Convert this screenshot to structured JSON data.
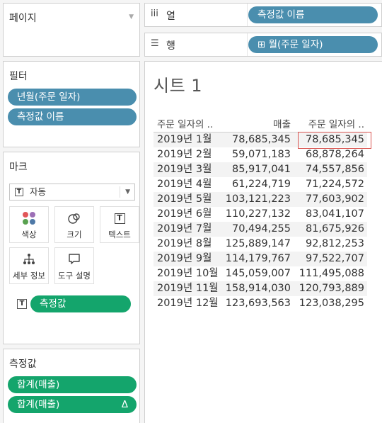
{
  "pages_card": {
    "title": "페이지"
  },
  "filters_card": {
    "title": "필터",
    "pills": [
      "년월(주문 일자)",
      "측정값 이름"
    ]
  },
  "marks_card": {
    "title": "마크",
    "mark_type": "자동",
    "buttons": {
      "color": "색상",
      "size": "크기",
      "text": "텍스트",
      "detail": "세부 정보",
      "tooltip": "도구 설명"
    },
    "text_pill": "측정값"
  },
  "measures_card": {
    "title": "측정값",
    "pills": [
      {
        "label": "합계(매출)",
        "delta": ""
      },
      {
        "label": "합계(매출)",
        "delta": "Δ"
      }
    ]
  },
  "columns_shelf": {
    "label": "열",
    "pill": "측정값 이름"
  },
  "rows_shelf": {
    "label": "행",
    "pill": "⊞ 월(주문 일자)"
  },
  "view": {
    "title": "시트 1",
    "headers": [
      "주문 일자의 ..",
      "매출",
      "주문 일자의 .."
    ],
    "rows": [
      [
        "2019년 1월",
        "78,685,345",
        "78,685,345"
      ],
      [
        "2019년 2월",
        "59,071,183",
        "68,878,264"
      ],
      [
        "2019년 3월",
        "85,917,041",
        "74,557,856"
      ],
      [
        "2019년 4월",
        "61,224,719",
        "71,224,572"
      ],
      [
        "2019년 5월",
        "103,121,223",
        "77,603,902"
      ],
      [
        "2019년 6월",
        "110,227,132",
        "83,041,107"
      ],
      [
        "2019년 7월",
        "70,494,255",
        "81,675,926"
      ],
      [
        "2019년 8월",
        "125,889,147",
        "92,812,253"
      ],
      [
        "2019년 9월",
        "114,179,767",
        "97,522,707"
      ],
      [
        "2019년 10월",
        "145,059,007",
        "111,495,088"
      ],
      [
        "2019년 11월",
        "158,914,030",
        "120,793,889"
      ],
      [
        "2019년 12월",
        "123,693,563",
        "123,038,295"
      ]
    ]
  },
  "colors": {
    "dimension_pill": "#4a8eae",
    "measure_pill": "#14a56c",
    "highlight": "#d9534f"
  }
}
